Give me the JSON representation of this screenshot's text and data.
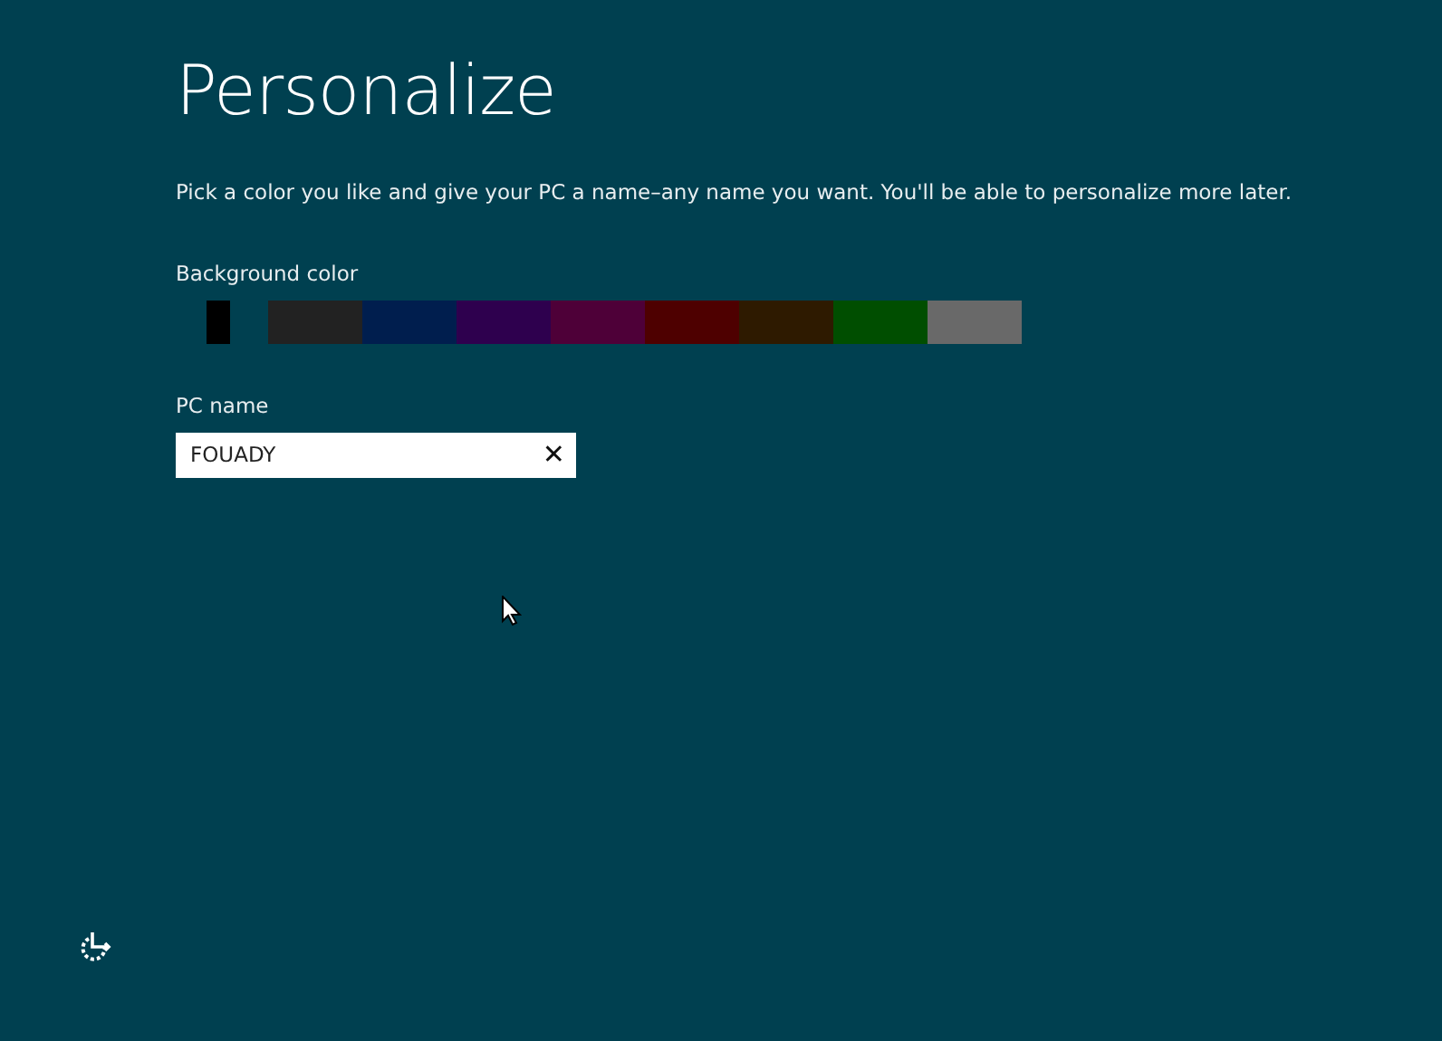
{
  "title": "Personalize",
  "description": "Pick a color you like and give your PC a name–any name you want. You'll be able to personalize more later.",
  "background_color": {
    "label": "Background color",
    "swatches": [
      {
        "kind": "slider",
        "color": "#004050",
        "level": 0.45
      },
      {
        "kind": "swatch",
        "color": "#222222"
      },
      {
        "kind": "swatch",
        "color": "#001e4e"
      },
      {
        "kind": "swatch",
        "color": "#2e004e"
      },
      {
        "kind": "swatch",
        "color": "#4e0038"
      },
      {
        "kind": "swatch",
        "color": "#4e0000"
      },
      {
        "kind": "swatch",
        "color": "#2e1a00"
      },
      {
        "kind": "swatch",
        "color": "#004e00"
      },
      {
        "kind": "swatch",
        "color": "#696969"
      }
    ]
  },
  "pc_name": {
    "label": "PC name",
    "value": "FOUADY",
    "clear": "✕"
  }
}
